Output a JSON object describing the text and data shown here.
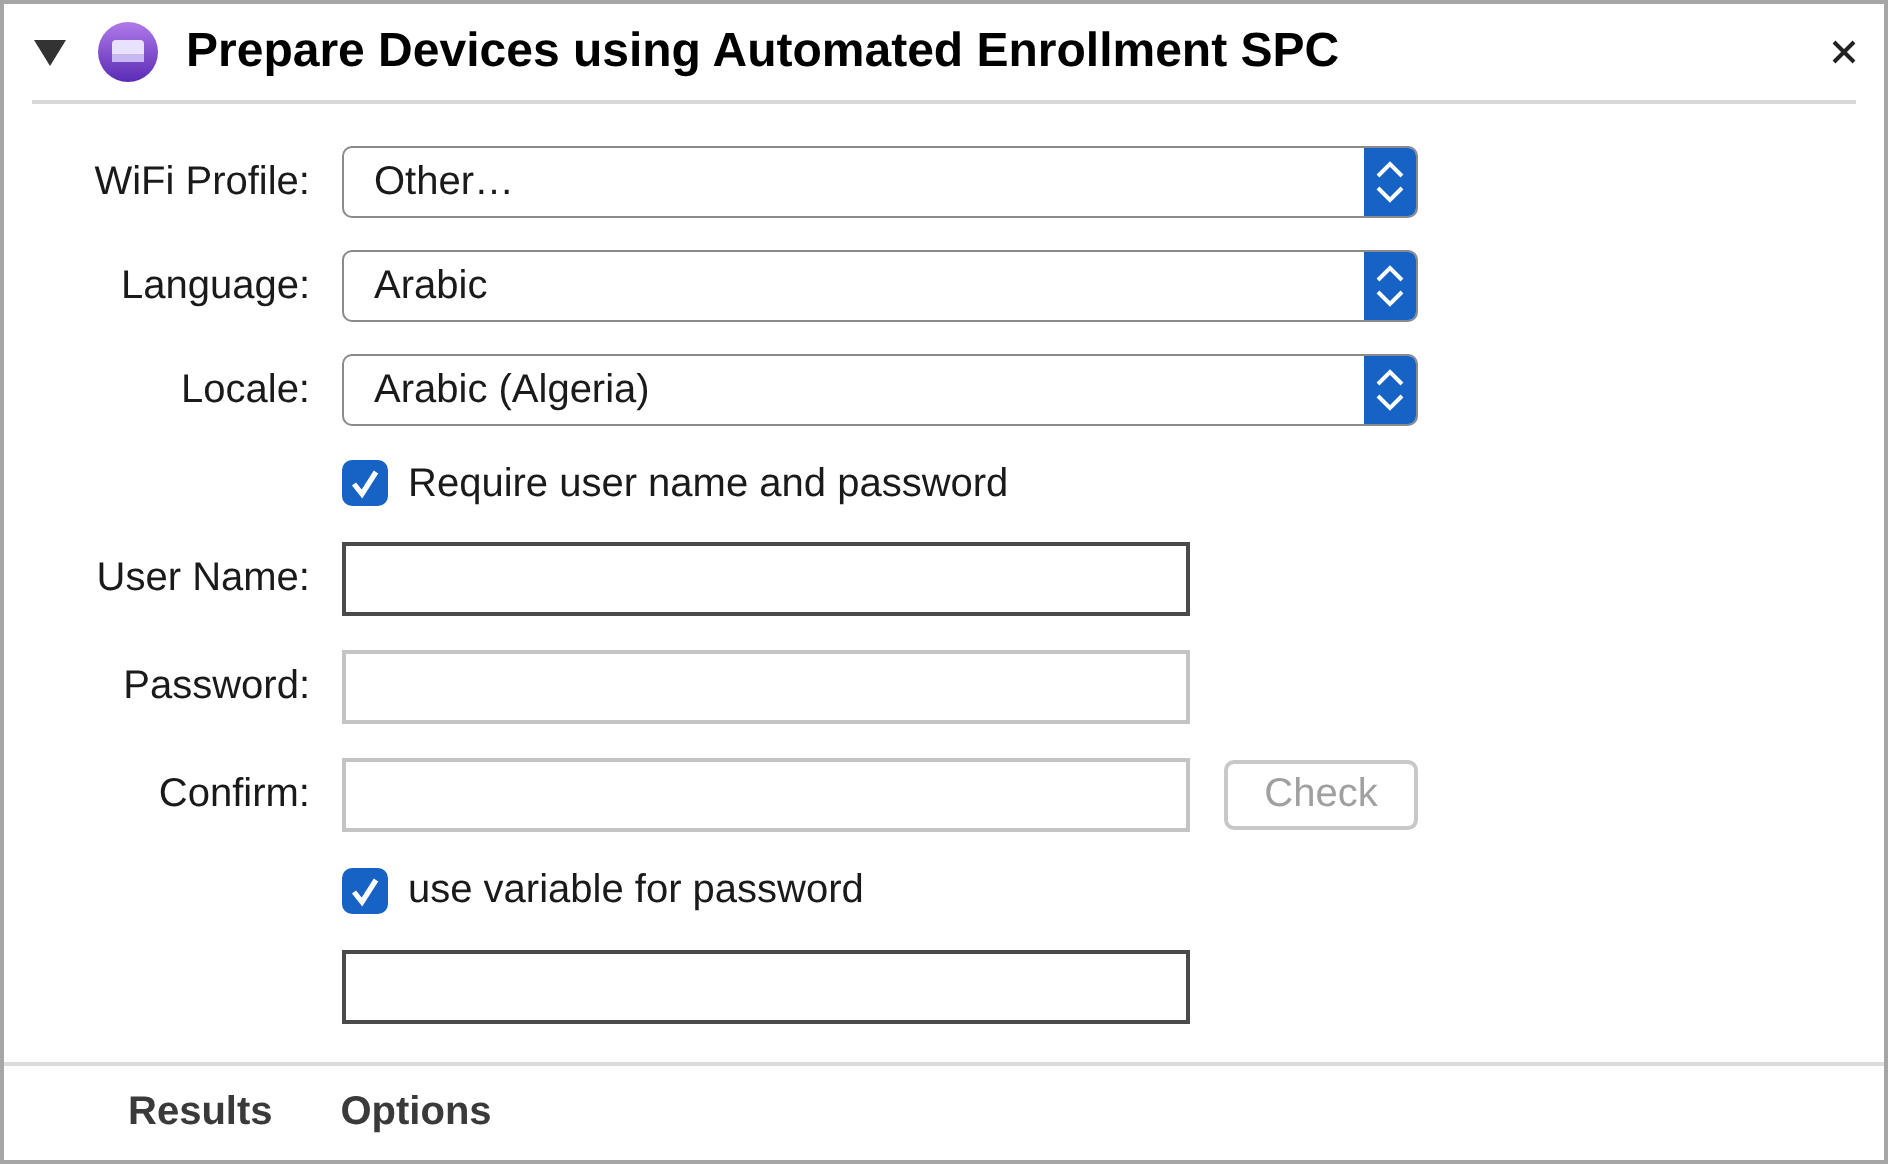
{
  "header": {
    "expanded": true,
    "title": "Prepare Devices using Automated Enrollment SPC"
  },
  "form": {
    "rows": [
      {
        "kind": "popup",
        "label": "WiFi Profile:",
        "value": "Other…"
      },
      {
        "kind": "popup",
        "label": "Language:",
        "value": "Arabic"
      },
      {
        "kind": "popup",
        "label": "Locale:",
        "value": "Arabic (Algeria)"
      },
      {
        "kind": "checkbox",
        "label": "Require user name and password",
        "checked": true
      },
      {
        "kind": "text",
        "label": "User Name:",
        "disabled": false
      },
      {
        "kind": "text",
        "label": "Password:",
        "disabled": true
      },
      {
        "kind": "text",
        "label": "Confirm:",
        "disabled": true,
        "button": {
          "label": "Check",
          "disabled": true
        }
      },
      {
        "kind": "checkbox",
        "label": "use variable for password",
        "checked": true
      },
      {
        "kind": "text",
        "disabled": false
      }
    ]
  },
  "tabs": [
    {
      "label": "Results"
    },
    {
      "label": "Options"
    }
  ]
}
